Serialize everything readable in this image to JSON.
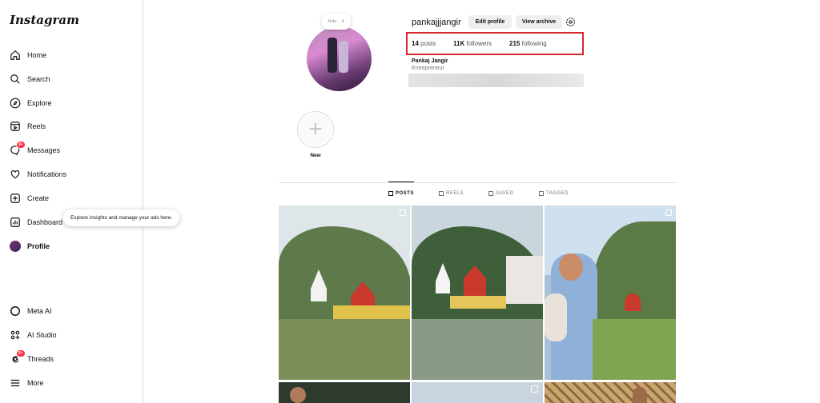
{
  "app": {
    "logo": "Instagram"
  },
  "sidebar": {
    "items": [
      {
        "label": "Home",
        "icon": "home-icon"
      },
      {
        "label": "Search",
        "icon": "search-icon"
      },
      {
        "label": "Explore",
        "icon": "compass-icon"
      },
      {
        "label": "Reels",
        "icon": "reels-icon"
      },
      {
        "label": "Messages",
        "icon": "messenger-icon",
        "badge": "9+"
      },
      {
        "label": "Notifications",
        "icon": "heart-icon"
      },
      {
        "label": "Create",
        "icon": "plus-square-icon"
      },
      {
        "label": "Dashboard",
        "icon": "chart-icon"
      },
      {
        "label": "Profile",
        "icon": "avatar"
      },
      {
        "label": "Meta AI",
        "icon": "meta-ai-icon"
      },
      {
        "label": "AI Studio",
        "icon": "ai-studio-icon"
      },
      {
        "label": "Threads",
        "icon": "threads-icon",
        "badge": "9+"
      },
      {
        "label": "More",
        "icon": "menu-icon"
      }
    ],
    "tooltip": "Explore insights and manage your ads here."
  },
  "profile": {
    "note": "Note...",
    "username": "pankajjjangir",
    "edit_profile": "Edit profile",
    "view_archive": "View archive",
    "posts_count": "14",
    "posts_label": "posts",
    "followers_count": "11K",
    "followers_label": "followers",
    "following_count": "215",
    "following_label": "following",
    "full_name": "Pankaj Jangir",
    "bio": "Entrepreneur"
  },
  "highlights": {
    "new_label": "New"
  },
  "tabs": [
    {
      "label": "POSTS",
      "active": true
    },
    {
      "label": "REELS",
      "active": false
    },
    {
      "label": "SAVED",
      "active": false
    },
    {
      "label": "TAGGED",
      "active": false
    }
  ],
  "colors": {
    "badge": "#ff3040",
    "highlight_box": "#d8262f"
  }
}
